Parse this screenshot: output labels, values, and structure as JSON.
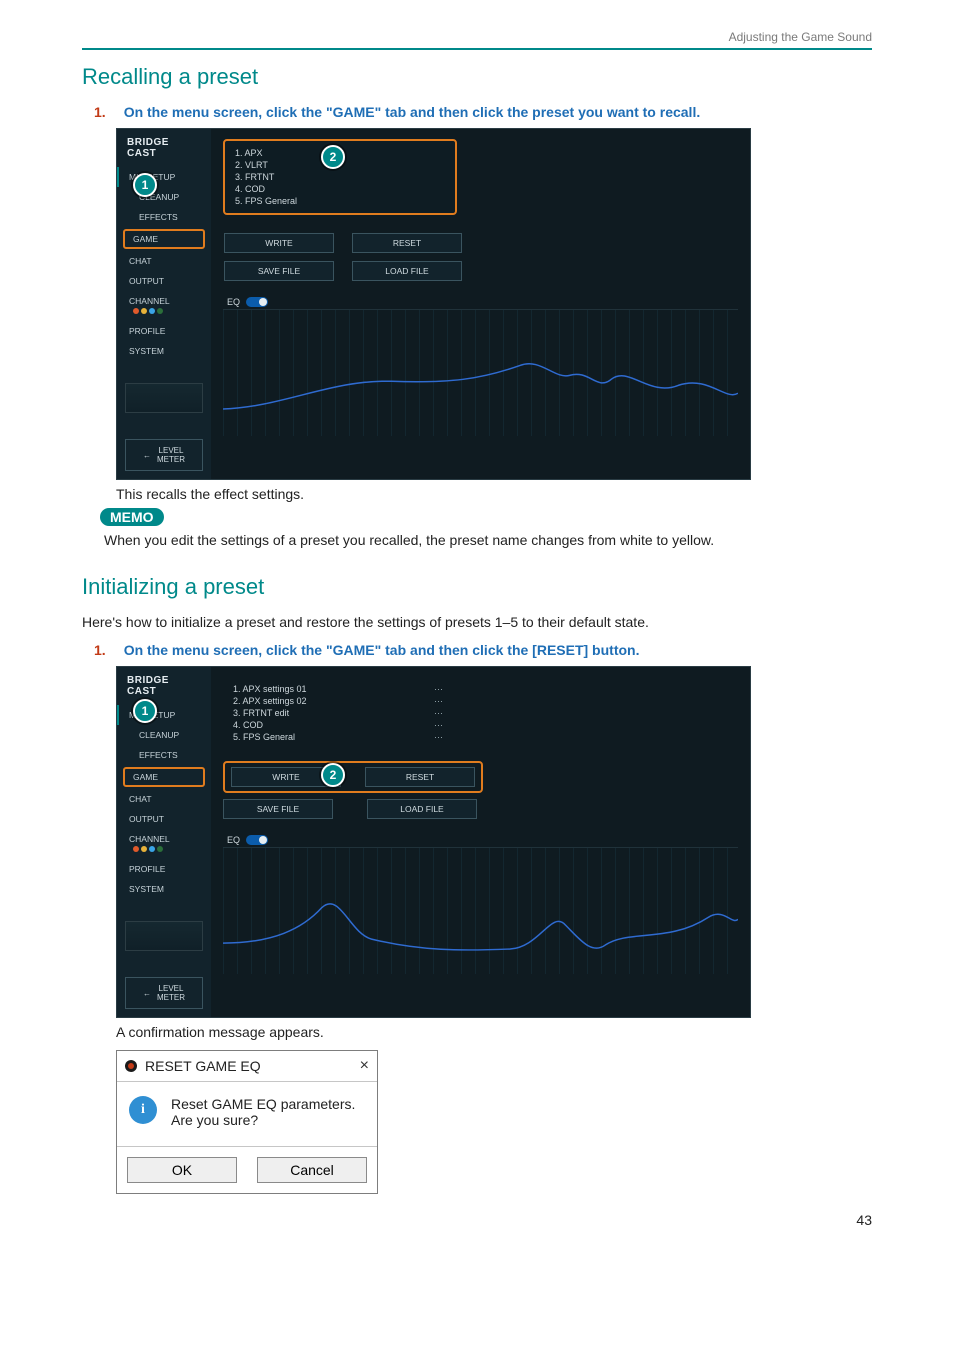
{
  "header": {
    "breadcrumb": "Adjusting the Game Sound"
  },
  "section1": {
    "title": "Recalling a preset",
    "step_num": "1.",
    "step_text": "On the menu screen, click the \"GAME\" tab and then click the preset you want to recall.",
    "caption": "This recalls the effect settings.",
    "memo_label": "MEMO",
    "memo_text": "When you edit the settings of a preset you recalled, the preset name changes from white to yellow."
  },
  "section2": {
    "title": "Initializing a preset",
    "intro": "Here's how to initialize a preset and restore the settings of presets 1–5 to their default state.",
    "step_num": "1.",
    "step_text": "On the menu screen, click the \"GAME\" tab and then click the [RESET] button.",
    "caption": "A confirmation message appears."
  },
  "app": {
    "brand": "BRIDGE CAST",
    "nav": {
      "mic_setup": "MIC SETUP",
      "cleanup": "CLEANUP",
      "effects": "EFFECTS",
      "game": "GAME",
      "chat": "CHAT",
      "output": "OUTPUT",
      "channel": "CHANNEL",
      "profile": "PROFILE",
      "system": "SYSTEM"
    },
    "level_meter": "LEVEL\nMETER",
    "buttons": {
      "write": "WRITE",
      "reset": "RESET",
      "save": "SAVE FILE",
      "load": "LOAD FILE"
    },
    "eq_label": "EQ",
    "presets_a": [
      "1. APX",
      "2. VLRT",
      "3. FRTNT",
      "4. COD",
      "5. FPS General"
    ],
    "presets_b": [
      "1. APX settings 01",
      "2. APX settings 02",
      "3. FRTNT edit",
      "4. COD",
      "5. FPS General"
    ],
    "markers": {
      "one": "1",
      "two": "2"
    }
  },
  "dialog": {
    "title": "RESET GAME EQ",
    "body1": "Reset GAME EQ parameters.",
    "body2": "Are you sure?",
    "ok": "OK",
    "cancel": "Cancel"
  },
  "page_number": "43"
}
